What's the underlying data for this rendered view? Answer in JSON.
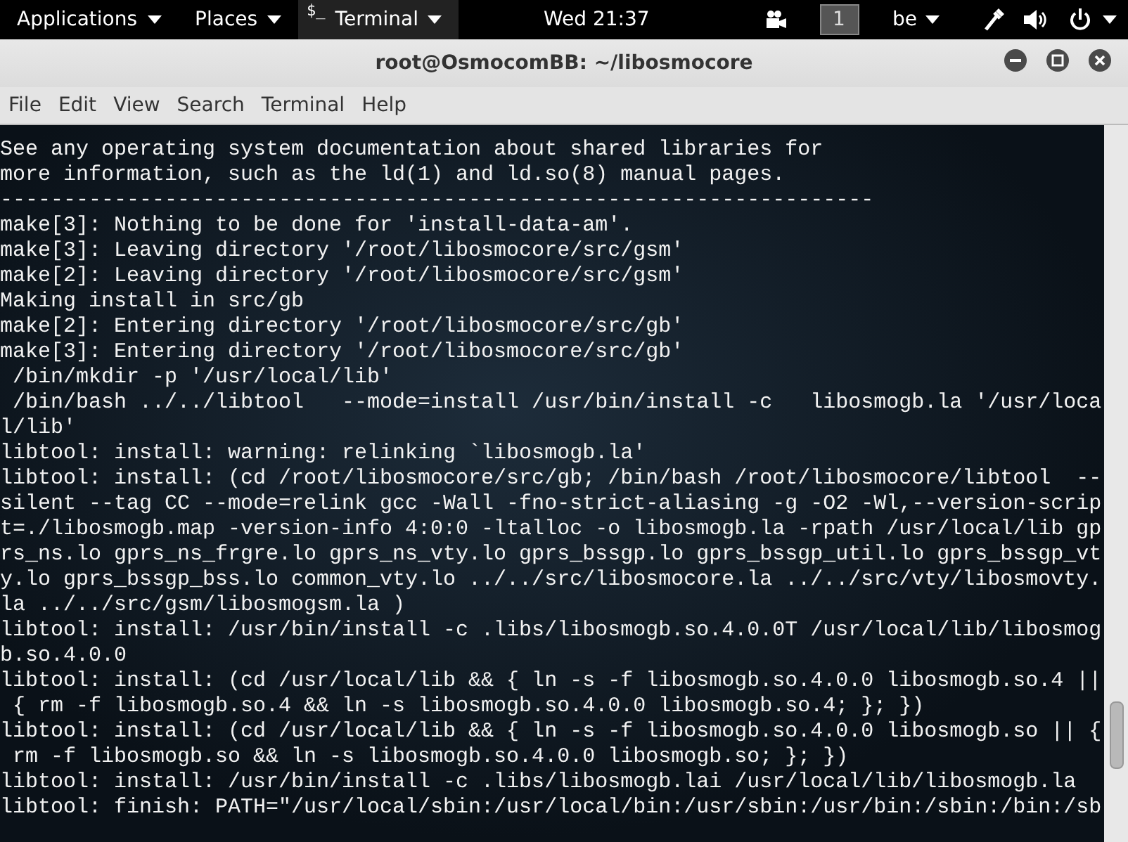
{
  "top_bar": {
    "menus": [
      {
        "label": "Applications"
      },
      {
        "label": "Places"
      },
      {
        "label": "Terminal",
        "app_icon": "$_"
      }
    ],
    "clock": "Wed 21:37",
    "workspace": "1",
    "keyboard_layout": "be"
  },
  "window": {
    "title": "root@OsmocomBB: ~/libosmocore"
  },
  "menu_bar": [
    {
      "label": "File"
    },
    {
      "label": "Edit"
    },
    {
      "label": "View"
    },
    {
      "label": "Search"
    },
    {
      "label": "Terminal"
    },
    {
      "label": "Help"
    }
  ],
  "terminal": {
    "lines": [
      "See any operating system documentation about shared libraries for",
      "more information, such as the ld(1) and ld.so(8) manual pages.",
      "---------------------------------------------------------------------",
      "make[3]: Nothing to be done for 'install-data-am'.",
      "make[3]: Leaving directory '/root/libosmocore/src/gsm'",
      "make[2]: Leaving directory '/root/libosmocore/src/gsm'",
      "Making install in src/gb",
      "make[2]: Entering directory '/root/libosmocore/src/gb'",
      "make[3]: Entering directory '/root/libosmocore/src/gb'",
      " /bin/mkdir -p '/usr/local/lib'",
      " /bin/bash ../../libtool   --mode=install /usr/bin/install -c   libosmogb.la '/usr/loca",
      "l/lib'",
      "libtool: install: warning: relinking `libosmogb.la'",
      "libtool: install: (cd /root/libosmocore/src/gb; /bin/bash /root/libosmocore/libtool  --",
      "silent --tag CC --mode=relink gcc -Wall -fno-strict-aliasing -g -O2 -Wl,--version-scrip",
      "t=./libosmogb.map -version-info 4:0:0 -ltalloc -o libosmogb.la -rpath /usr/local/lib gp",
      "rs_ns.lo gprs_ns_frgre.lo gprs_ns_vty.lo gprs_bssgp.lo gprs_bssgp_util.lo gprs_bssgp_vt",
      "y.lo gprs_bssgp_bss.lo common_vty.lo ../../src/libosmocore.la ../../src/vty/libosmovty.",
      "la ../../src/gsm/libosmogsm.la )",
      "libtool: install: /usr/bin/install -c .libs/libosmogb.so.4.0.0T /usr/local/lib/libosmog",
      "b.so.4.0.0",
      "libtool: install: (cd /usr/local/lib && { ln -s -f libosmogb.so.4.0.0 libosmogb.so.4 ||",
      " { rm -f libosmogb.so.4 && ln -s libosmogb.so.4.0.0 libosmogb.so.4; }; })",
      "libtool: install: (cd /usr/local/lib && { ln -s -f libosmogb.so.4.0.0 libosmogb.so || {",
      " rm -f libosmogb.so && ln -s libosmogb.so.4.0.0 libosmogb.so; }; })",
      "libtool: install: /usr/bin/install -c .libs/libosmogb.lai /usr/local/lib/libosmogb.la",
      "libtool: finish: PATH=\"/usr/local/sbin:/usr/local/bin:/usr/sbin:/usr/bin:/sbin:/bin:/sb"
    ]
  }
}
